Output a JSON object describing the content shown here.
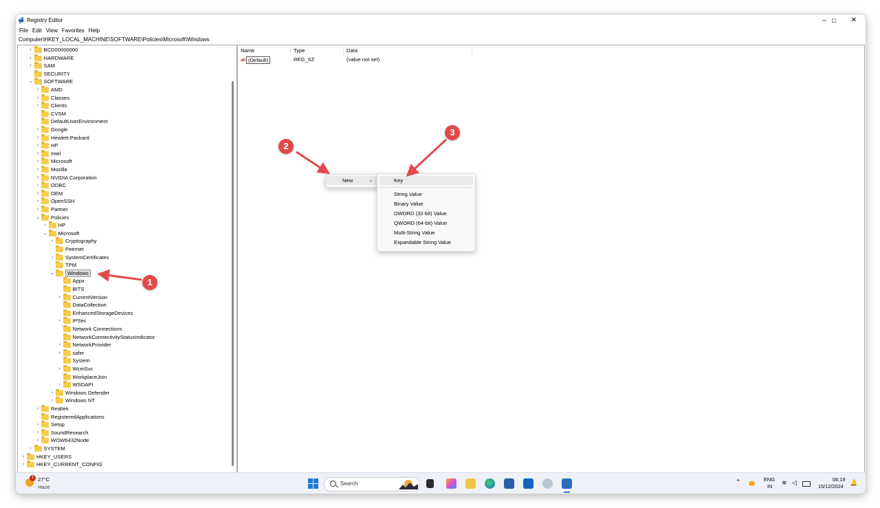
{
  "window": {
    "title": "Registry Editor",
    "controls": {
      "minimize": "–",
      "maximize": "▢",
      "close": "✕"
    }
  },
  "menu": [
    "File",
    "Edit",
    "View",
    "Favorites",
    "Help"
  ],
  "address": "Computer\\HKEY_LOCAL_MACHINE\\SOFTWARE\\Policies\\Microsoft\\Windows",
  "tree": [
    {
      "label": "BCD00000000",
      "chev": "›"
    },
    {
      "label": "HARDWARE",
      "chev": "›"
    },
    {
      "label": "SAM",
      "chev": "›"
    },
    {
      "label": "SECURITY",
      "chev": ""
    },
    {
      "label": "SOFTWARE",
      "chev": "⌄"
    },
    {
      "label": "AMD",
      "chev": "›"
    },
    {
      "label": "Classes",
      "chev": "›"
    },
    {
      "label": "Clients",
      "chev": "›"
    },
    {
      "label": "CVSM",
      "chev": ""
    },
    {
      "label": "DefaultUserEnvironment",
      "chev": ""
    },
    {
      "label": "Google",
      "chev": "›"
    },
    {
      "label": "Hewlett-Packard",
      "chev": "›"
    },
    {
      "label": "HP",
      "chev": "›"
    },
    {
      "label": "Intel",
      "chev": "›"
    },
    {
      "label": "Microsoft",
      "chev": "›"
    },
    {
      "label": "Mozilla",
      "chev": "›"
    },
    {
      "label": "NVIDIA Corporation",
      "chev": "›"
    },
    {
      "label": "ODBC",
      "chev": "›"
    },
    {
      "label": "OEM",
      "chev": "›"
    },
    {
      "label": "OpenSSH",
      "chev": "›"
    },
    {
      "label": "Partner",
      "chev": "›"
    },
    {
      "label": "Policies",
      "chev": "⌄"
    },
    {
      "label": "HP",
      "chev": "›"
    },
    {
      "label": "Microsoft",
      "chev": "⌄"
    },
    {
      "label": "Cryptography",
      "chev": "›"
    },
    {
      "label": "Peernet",
      "chev": ""
    },
    {
      "label": "SystemCertificates",
      "chev": "›"
    },
    {
      "label": "TPM",
      "chev": ""
    },
    {
      "label": "Windows",
      "chev": "⌄",
      "selected": true
    },
    {
      "label": "Appx",
      "chev": ""
    },
    {
      "label": "BITS",
      "chev": ""
    },
    {
      "label": "CurrentVersion",
      "chev": "›"
    },
    {
      "label": "DataCollection",
      "chev": ""
    },
    {
      "label": "EnhancedStorageDevices",
      "chev": ""
    },
    {
      "label": "IPSec",
      "chev": "›"
    },
    {
      "label": "Network Connections",
      "chev": ""
    },
    {
      "label": "NetworkConnectivityStatusIndicator",
      "chev": ""
    },
    {
      "label": "NetworkProvider",
      "chev": "›"
    },
    {
      "label": "safer",
      "chev": "›"
    },
    {
      "label": "System",
      "chev": ""
    },
    {
      "label": "WcmSvc",
      "chev": "›"
    },
    {
      "label": "WorkplaceJoin",
      "chev": ""
    },
    {
      "label": "WSDAPI",
      "chev": "›"
    },
    {
      "label": "Windows Defender",
      "chev": "›"
    },
    {
      "label": "Windows NT",
      "chev": "›"
    },
    {
      "label": "Realtek",
      "chev": "›"
    },
    {
      "label": "RegisteredApplications",
      "chev": ""
    },
    {
      "label": "Setup",
      "chev": "›"
    },
    {
      "label": "SoundResearch",
      "chev": "›"
    },
    {
      "label": "WOW6432Node",
      "chev": "›"
    },
    {
      "label": "SYSTEM",
      "chev": "›"
    },
    {
      "label": "HKEY_USERS",
      "chev": "›"
    },
    {
      "label": "HKEY_CURRENT_CONFIG",
      "chev": "›"
    }
  ],
  "columns": {
    "name": "Name",
    "type": "Type",
    "data": "Data"
  },
  "values": [
    {
      "icon": "ab",
      "name": "(Default)",
      "type": "REG_SZ",
      "data": "(value not set)"
    }
  ],
  "context_menu": {
    "new_label": "New",
    "new_arrow": "›",
    "submenu": {
      "key": "Key",
      "items": [
        "String Value",
        "Binary Value",
        "DWORD (32-bit) Value",
        "QWORD (64-bit) Value",
        "Multi-String Value",
        "Expandable String Value"
      ]
    }
  },
  "annotations": {
    "step1": "1",
    "step2": "2",
    "step3": "3",
    "color": "#e24a4a"
  },
  "taskbar": {
    "badge": "1",
    "temperature": "27°C",
    "condition": "Haze",
    "search_placeholder": "Search",
    "lang_top": "ENG",
    "lang_bottom": "IN",
    "time": "06:19",
    "date": "15/12/2024",
    "tray_chevron": "⌃"
  }
}
